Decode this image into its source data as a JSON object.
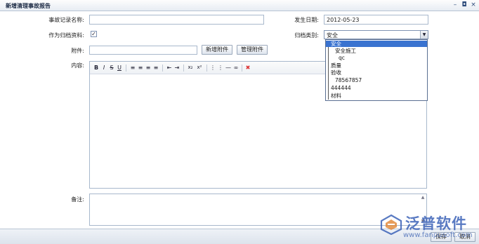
{
  "window": {
    "title": "新增清理事故报告",
    "ctl_min": "–",
    "ctl_restore": "◘",
    "ctl_close": "×"
  },
  "form": {
    "record_name_label": "事故记录名称:",
    "record_name_value": "",
    "date_label": "发生日期:",
    "date_value": "2012-05-23",
    "archive_label": "作为归档资料:",
    "archive_checked": true,
    "archive_check_glyph": "✓",
    "category_label": "归档类别:",
    "category_value": "安全",
    "attachment_label": "附件:",
    "attachment_value": "",
    "add_attachment_button": "新增附件",
    "manage_attachment_button": "管理附件",
    "content_label": "内容:",
    "remark_label": "备注:"
  },
  "category_dropdown": {
    "options": [
      {
        "label": "安全",
        "selected": true
      },
      {
        "label": "安全施工",
        "selected": false
      },
      {
        "label": "qc",
        "selected": false
      },
      {
        "label": "质量",
        "selected": false
      },
      {
        "label": "验收",
        "selected": false
      },
      {
        "label": "78567857",
        "selected": false
      },
      {
        "label": "444444",
        "selected": false
      },
      {
        "label": "材料",
        "selected": false
      }
    ]
  },
  "editor_toolbar": {
    "bold": "B",
    "italic": "I",
    "strike": "S",
    "underline": "U",
    "align_left": "≡",
    "align_center": "≡",
    "align_right": "≡",
    "justify": "≡",
    "outdent": "⇤",
    "indent": "⇥",
    "subscript": "x₂",
    "superscript": "x²",
    "ordered_list": "⋮",
    "unordered_list": "⋮",
    "hr": "—",
    "link": "∞",
    "remove_format": "✖"
  },
  "footer": {
    "save_button": "保存",
    "cancel_button": "取消"
  },
  "watermark": {
    "brand": "泛普软件",
    "url": "www.fanpusoft.com"
  },
  "colors": {
    "accent": "#3a73d0",
    "border": "#a8b8cc",
    "brand": "#3d63b8",
    "remove_format": "#d33"
  }
}
